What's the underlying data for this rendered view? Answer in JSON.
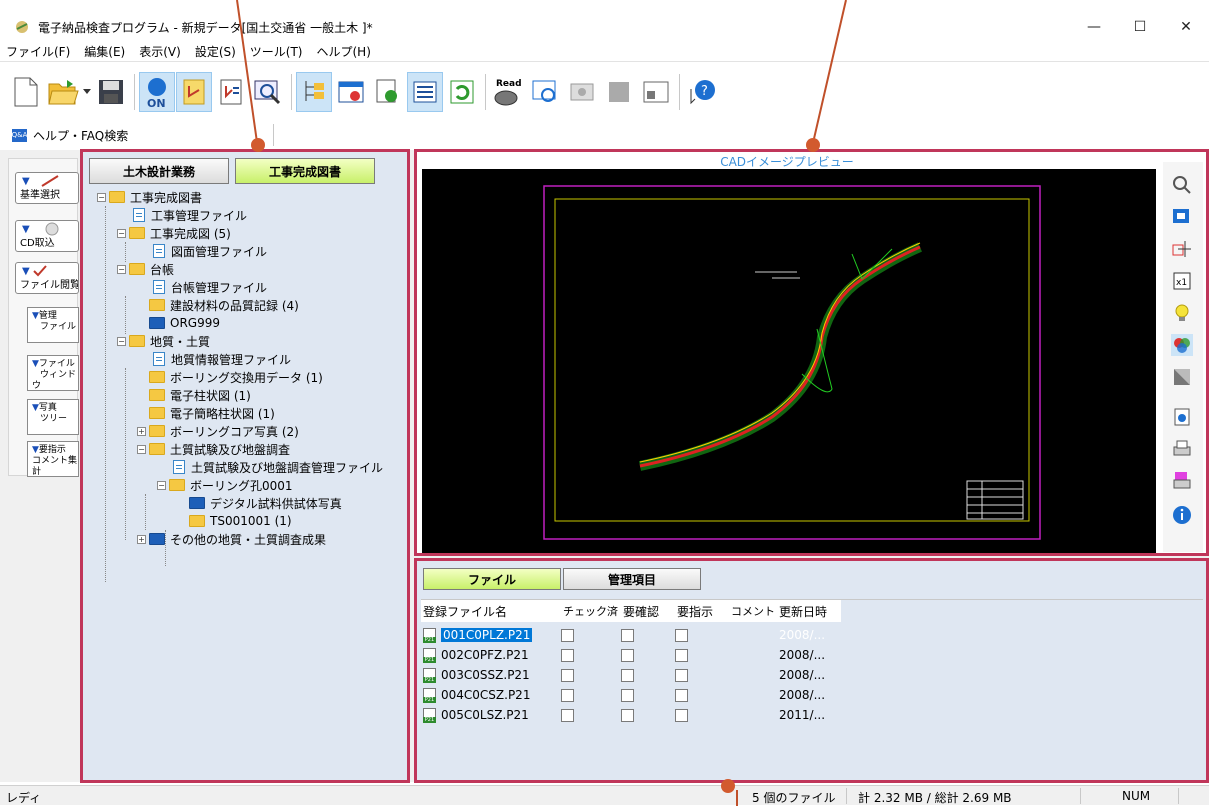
{
  "window": {
    "title": "電子納品検査プログラム - 新規データ[国土交通省 一般土木 ]*",
    "minimize": "—",
    "maximize": "☐",
    "close": "✕"
  },
  "menu": [
    "ファイル(F)",
    "編集(E)",
    "表示(V)",
    "設定(S)",
    "ツール(T)",
    "ヘルプ(H)"
  ],
  "toolbar": {
    "read_label": "Read",
    "on_label": "ON"
  },
  "helpbar": {
    "icon_text": "Q&A",
    "label": "ヘルプ・FAQ検索"
  },
  "quick_buttons": [
    "基準選択",
    "CD取込",
    "ファイル閲覧"
  ],
  "side_buttons": [
    {
      "line1": "管理",
      "line2": "ファイル"
    },
    {
      "line1": "ファイル",
      "line2": "ウィンドウ"
    },
    {
      "line1": "写真",
      "line2": "ツリー"
    },
    {
      "line1": "要指示",
      "line2": "コメント集計"
    }
  ],
  "tree_tabs": [
    "土木設計業務",
    "工事完成図書"
  ],
  "tree": [
    "工事完成図書",
    "工事管理ファイル",
    "工事完成図 (5)",
    "図面管理ファイル",
    "台帳",
    "台帳管理ファイル",
    "建設材料の品質記録 (4)",
    "ORG999",
    "地質・土質",
    "地質情報管理ファイル",
    "ボーリング交換用データ (1)",
    "電子柱状図 (1)",
    "電子簡略柱状図 (1)",
    "ボーリングコア写真 (2)",
    "土質試験及び地盤調査",
    "土質試験及び地盤調査管理ファイル",
    "ボーリング孔0001",
    "デジタル試料供試体写真",
    "TS001001 (1)",
    "その他の地質・土質調査成果"
  ],
  "cad": {
    "title": "CADイメージプレビュー"
  },
  "file_tabs": [
    "ファイル",
    "管理項目"
  ],
  "file_columns": [
    "登録ファイル名",
    "チェック済",
    "要確認",
    "要指示",
    "コメント",
    "更新日時"
  ],
  "files": [
    {
      "name": "001C0PLZ.P21",
      "date": "2008/..."
    },
    {
      "name": "002C0PFZ.P21",
      "date": "2008/..."
    },
    {
      "name": "003C0SSZ.P21",
      "date": "2008/..."
    },
    {
      "name": "004C0CSZ.P21",
      "date": "2008/..."
    },
    {
      "name": "005C0LSZ.P21",
      "date": "2011/..."
    }
  ],
  "status": {
    "ready": "レディ",
    "file_count": "5 個のファイル",
    "size": "計 2.32 MB / 総計 2.69 MB",
    "num": "NUM"
  },
  "colors": {
    "highlight_border": "#c0365a",
    "panel_bg": "#dfe7f2",
    "active_tab": "#c8f06a",
    "callout": "#c0502a"
  }
}
